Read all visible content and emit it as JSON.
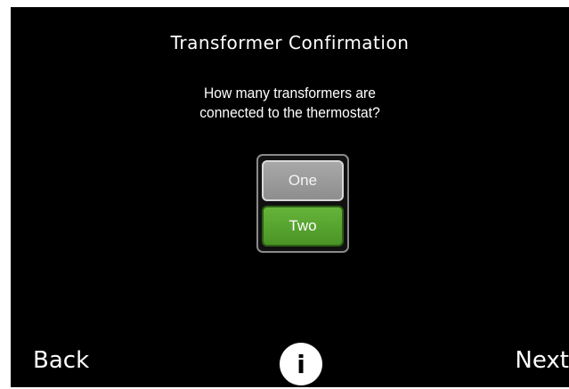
{
  "screen": {
    "title": "Transformer Confirmation",
    "question_line1": "How many transformers are",
    "question_line2": "connected to the thermostat?"
  },
  "options": {
    "items": [
      {
        "label": "One",
        "selected": false
      },
      {
        "label": "Two",
        "selected": true
      }
    ]
  },
  "footer": {
    "back_label": "Back",
    "info_icon": "i",
    "next_label": "Next"
  },
  "colors": {
    "background": "#000000",
    "selected": "#55a32e",
    "unselected": "#9b9b9b",
    "text": "#ffffff"
  },
  "icons": {
    "info": "info-icon"
  }
}
